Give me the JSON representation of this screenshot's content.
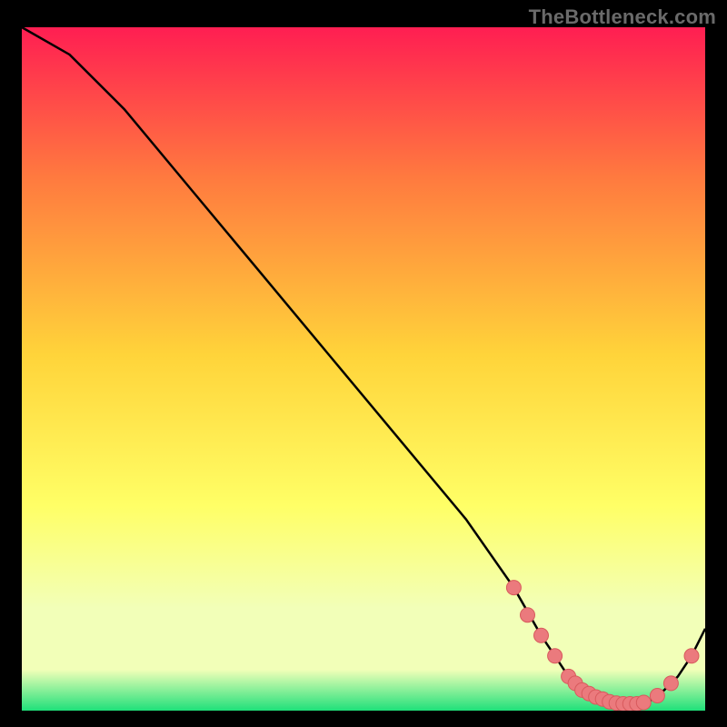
{
  "watermark": "TheBottleneck.com",
  "colors": {
    "page_bg": "#000000",
    "gradient_top": "#ff1e52",
    "gradient_mid_upper": "#ff7a3f",
    "gradient_mid": "#ffd43a",
    "gradient_mid_lower": "#ffff66",
    "gradient_lower": "#f2ffb8",
    "gradient_bottom": "#1fe07a",
    "curve": "#000000",
    "marker_fill": "#eb7a7d",
    "marker_stroke": "#d85a5d"
  },
  "chart_data": {
    "type": "line",
    "title": "",
    "xlabel": "",
    "ylabel": "",
    "xlim": [
      0,
      100
    ],
    "ylim": [
      0,
      100
    ],
    "series": [
      {
        "name": "bottleneck-curve",
        "x": [
          0,
          7,
          15,
          25,
          35,
          45,
          55,
          65,
          72,
          76,
          78,
          80,
          82,
          84,
          86,
          88,
          90,
          92,
          94,
          96,
          98,
          100
        ],
        "y": [
          100,
          96,
          88,
          76,
          64,
          52,
          40,
          28,
          18,
          11,
          8,
          5,
          3,
          2,
          1.2,
          1,
          1,
          1.5,
          3,
          5,
          8,
          12
        ]
      }
    ],
    "markers": [
      {
        "x": 72,
        "y": 18
      },
      {
        "x": 74,
        "y": 14
      },
      {
        "x": 76,
        "y": 11
      },
      {
        "x": 78,
        "y": 8
      },
      {
        "x": 80,
        "y": 5
      },
      {
        "x": 81,
        "y": 4
      },
      {
        "x": 82,
        "y": 3
      },
      {
        "x": 83,
        "y": 2.5
      },
      {
        "x": 84,
        "y": 2
      },
      {
        "x": 85,
        "y": 1.7
      },
      {
        "x": 86,
        "y": 1.3
      },
      {
        "x": 87,
        "y": 1.1
      },
      {
        "x": 88,
        "y": 1
      },
      {
        "x": 89,
        "y": 1
      },
      {
        "x": 90,
        "y": 1
      },
      {
        "x": 91,
        "y": 1.2
      },
      {
        "x": 93,
        "y": 2.2
      },
      {
        "x": 95,
        "y": 4
      },
      {
        "x": 98,
        "y": 8
      }
    ]
  }
}
